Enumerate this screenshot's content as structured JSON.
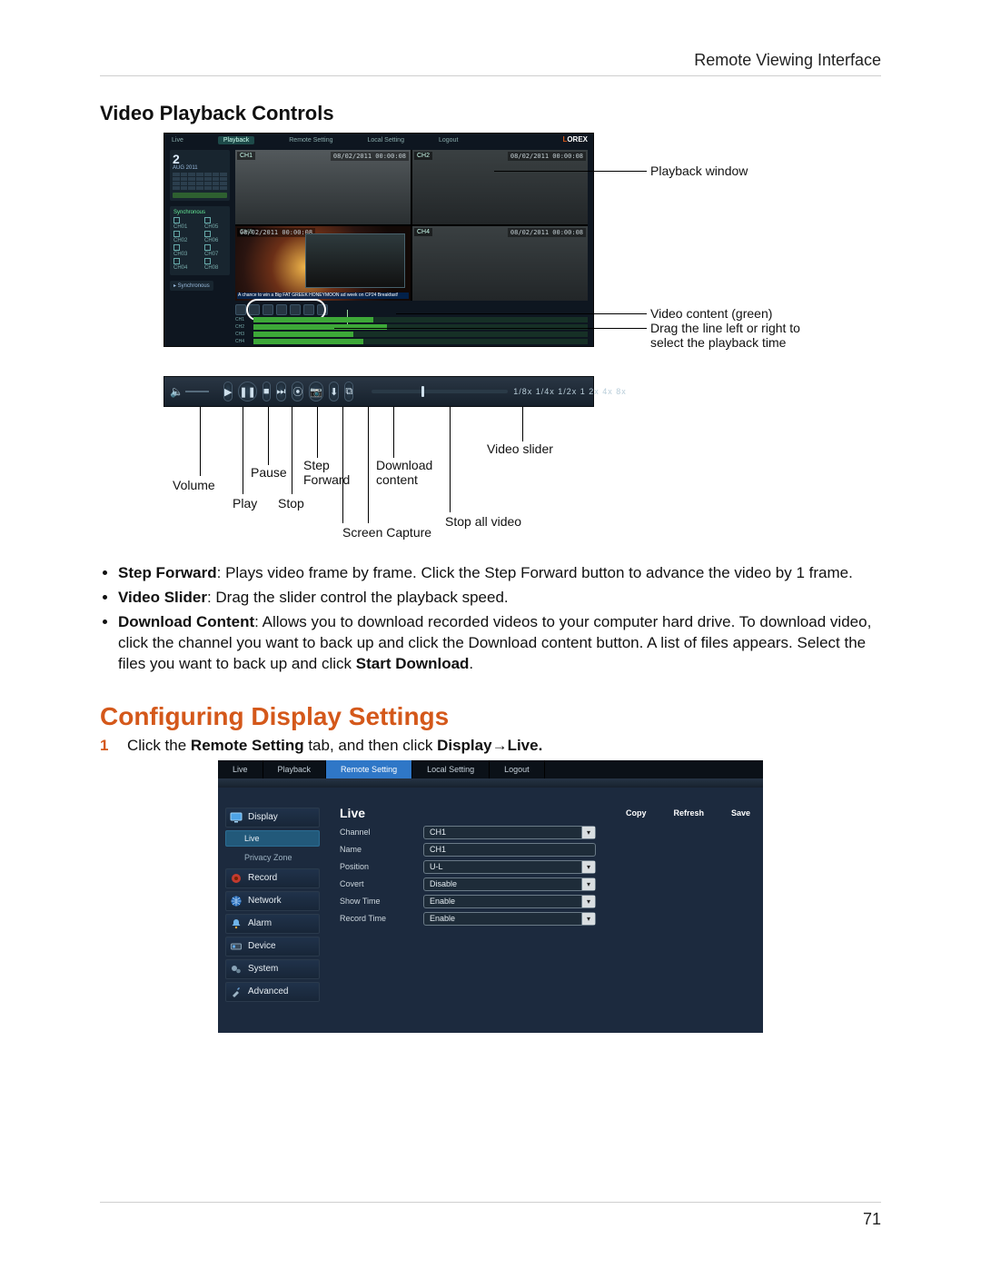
{
  "header": {
    "chapter": "Remote Viewing Interface"
  },
  "footer": {
    "page": "71"
  },
  "section1": {
    "title": "Video Playback Controls",
    "app": {
      "tabs": [
        "Live",
        "Playback",
        "Remote Setting",
        "Local Setting",
        "Logout"
      ],
      "logo_left": "L",
      "logo_right": "OREX",
      "calendar": {
        "day": "2",
        "month_year": "AUG 2011"
      },
      "channel_list": {
        "title": "Synchronous",
        "rows": [
          [
            "CH01",
            "CH05"
          ],
          [
            "CH02",
            "CH06"
          ],
          [
            "CH03",
            "CH07"
          ],
          [
            "CH04",
            "CH08"
          ]
        ]
      },
      "timestamp": "08/02/2011  00:00:08",
      "ch_labels": [
        "CH1",
        "CH2",
        "CH3",
        "CH4"
      ],
      "promo": "A chance to win a Big FAT GREEK HONEYMOON ad week on CP24 Breakfast!",
      "tracks": [
        "CH1",
        "CH2",
        "CH3",
        "CH4"
      ]
    },
    "toolbar": {
      "speed_labels": "1/8x 1/4x 1/2x   1    2x   4x   8x"
    },
    "annotations": {
      "playback_window": "Playback window",
      "video_content": "Video content (green)",
      "drag_note": "Drag the line left or right to select the playback time",
      "video_slider": "Video slider",
      "volume": "Volume",
      "pause": "Pause",
      "step_forward": "Step\nForward",
      "download": "Download\ncontent",
      "play": "Play",
      "stop": "Stop",
      "screen_capture": "Screen Capture",
      "stop_all": "Stop all video"
    },
    "bullets": {
      "sf_label": "Step Forward",
      "sf_text": ": Plays video frame by frame. Click the Step Forward button to advance the video by 1 frame.",
      "vs_label": "Video Slider",
      "vs_text": ": Drag the slider control the playback speed.",
      "dl_label": "Download Content",
      "dl_text": ": Allows you to download recorded videos to your computer hard drive. To download video, click the channel you want to back up and click the Download content button. A list of files appears. Select the files you want to back up and click ",
      "dl_bold": "Start Download",
      "dl_tail": "."
    }
  },
  "section2": {
    "title": "Configuring Display Settings",
    "step_pre": "Click the ",
    "step_b1": "Remote Setting",
    "step_mid": " tab, and then click ",
    "step_b2": "Display",
    "step_arrow": "→",
    "step_b3": "Live.",
    "tabs": [
      "Live",
      "Playback",
      "Remote Setting",
      "Local Setting",
      "Logout"
    ],
    "sidebar": [
      {
        "name": "display",
        "label": "Display"
      },
      {
        "name": "live",
        "label": "Live",
        "sub": true,
        "active": true
      },
      {
        "name": "privacy",
        "label": "Privacy Zone",
        "sub": true
      },
      {
        "name": "record",
        "label": "Record"
      },
      {
        "name": "network",
        "label": "Network"
      },
      {
        "name": "alarm",
        "label": "Alarm"
      },
      {
        "name": "device",
        "label": "Device"
      },
      {
        "name": "system",
        "label": "System"
      },
      {
        "name": "advanced",
        "label": "Advanced"
      }
    ],
    "panel": {
      "title": "Live",
      "buttons": [
        "Copy",
        "Refresh",
        "Save"
      ],
      "rows": [
        {
          "label": "Channel",
          "value": "CH1",
          "dd": true
        },
        {
          "label": "Name",
          "value": "CH1",
          "dd": false
        },
        {
          "label": "Position",
          "value": "U-L",
          "dd": true
        },
        {
          "label": "Covert",
          "value": "Disable",
          "dd": true
        },
        {
          "label": "Show Time",
          "value": "Enable",
          "dd": true
        },
        {
          "label": "Record Time",
          "value": "Enable",
          "dd": true
        }
      ]
    }
  }
}
